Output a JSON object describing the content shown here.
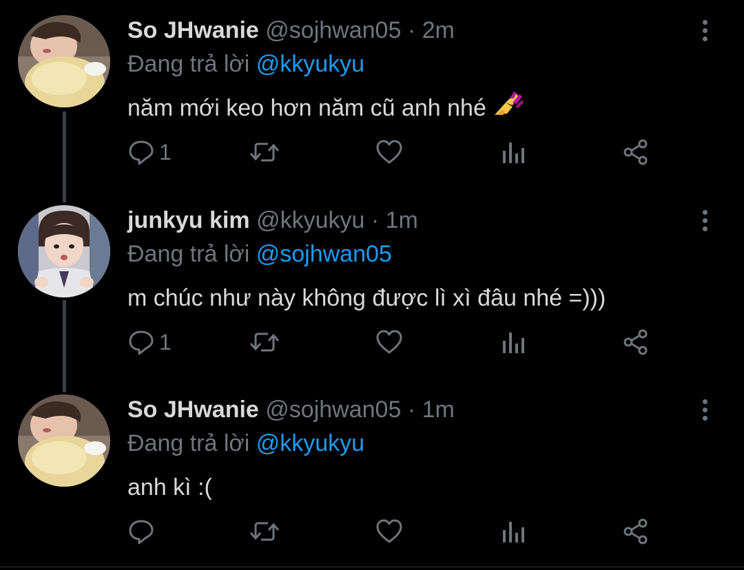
{
  "tweets": [
    {
      "display_name": "So JHwanie",
      "handle": "@sojhwan05",
      "separator": "·",
      "time": "2m",
      "reply_prefix": "Đang trả lời",
      "reply_to": "@kkyukyu",
      "text": "năm mới keo hơn năm cũ anh nhé",
      "emoji": "nail-polish-emoji",
      "reply_count": "1",
      "avatar": "avatar-sojhwanie"
    },
    {
      "display_name": "junkyu kim",
      "handle": "@kkyukyu",
      "separator": "·",
      "time": "1m",
      "reply_prefix": "Đang trả lời",
      "reply_to": "@sojhwan05",
      "text": "m chúc như này không được lì xì đâu nhé =)))",
      "reply_count": "1",
      "avatar": "avatar-junkyu"
    },
    {
      "display_name": "So JHwanie",
      "handle": "@sojhwan05",
      "separator": "·",
      "time": "1m",
      "reply_prefix": "Đang trả lời",
      "reply_to": "@kkyukyu",
      "text": "anh kì :(",
      "reply_count": "",
      "avatar": "avatar-sojhwanie"
    }
  ],
  "colors": {
    "background": "#000000",
    "text": "#d9d9d9",
    "secondary": "#6e767d",
    "accent": "#1d9bf0",
    "thread_line": "#3a3f44"
  },
  "icons": [
    "reply-icon",
    "retweet-icon",
    "like-icon",
    "analytics-icon",
    "share-icon",
    "more-icon"
  ]
}
